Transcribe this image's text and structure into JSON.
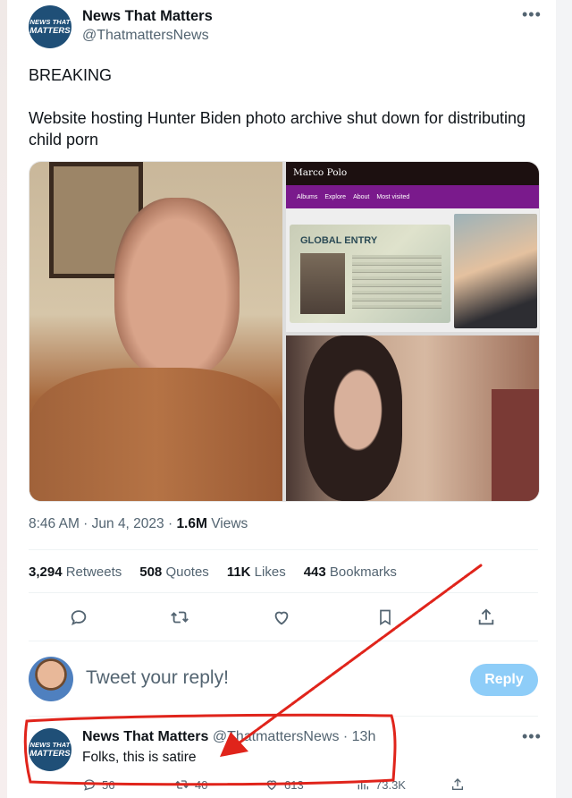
{
  "account": {
    "name": "News That Matters",
    "handle": "@ThatmattersNews",
    "avatar_line1": "NEWS THAT",
    "avatar_line2": "MATTERS",
    "more_icon": "more-horizontal-icon"
  },
  "tweet": {
    "line1": "BREAKING",
    "line2": "Website hosting Hunter Biden photo archive shut down for distributing child porn",
    "time": "8:46 AM · Jun 4, 2023 · ",
    "views_count": "1.6M",
    "views_label": " Views"
  },
  "media": {
    "site_name": "Marco Polo",
    "nav_items": [
      "Albums",
      "Explore",
      "About",
      "Most visited"
    ],
    "card_title": "GLOBAL ENTRY"
  },
  "stats": {
    "retweets_count": "3,294",
    "retweets_label": " Retweets",
    "quotes_count": "508",
    "quotes_label": " Quotes",
    "likes_count": "11K",
    "likes_label": " Likes",
    "bookmarks_count": "443",
    "bookmarks_label": " Bookmarks"
  },
  "actions": {
    "icons": [
      "reply-icon",
      "retweet-icon",
      "like-icon",
      "bookmark-icon",
      "share-icon"
    ]
  },
  "composer": {
    "placeholder": "Tweet your reply!",
    "button_label": "Reply"
  },
  "reply": {
    "name": "News That Matters",
    "handle": "@ThatmattersNews",
    "time": " · 13h",
    "text": "Folks, this is satire",
    "replies": "56",
    "retweets": "40",
    "likes": "613",
    "views": "73.3K"
  },
  "annotation": {
    "color": "#e0241b"
  }
}
